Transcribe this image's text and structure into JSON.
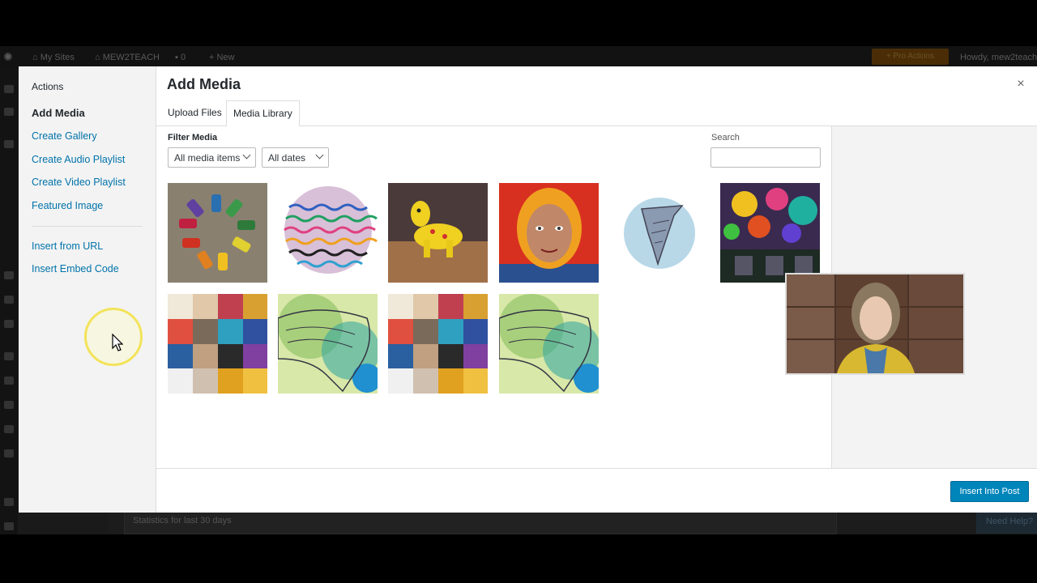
{
  "admin_bar": {
    "my_sites": "My Sites",
    "site_name": "MEW2TEACH",
    "comments_count": "0",
    "new_label": "New",
    "pro_actions": "Pro Actions",
    "howdy": "Howdy, mew2teach"
  },
  "admin_background": {
    "stats_title": "Statistics for last 30 days",
    "help_tab": "Need Help?"
  },
  "modal": {
    "title": "Add Media",
    "close_label": "×",
    "menu": {
      "heading": "Actions",
      "items": [
        {
          "label": "Add Media",
          "active": true
        },
        {
          "label": "Create Gallery"
        },
        {
          "label": "Create Audio Playlist"
        },
        {
          "label": "Create Video Playlist"
        },
        {
          "label": "Featured Image"
        },
        {
          "label": "Insert from URL"
        },
        {
          "label": "Insert Embed Code"
        }
      ]
    },
    "tabs": [
      {
        "label": "Upload Files"
      },
      {
        "label": "Media Library",
        "active": true
      }
    ],
    "filters": {
      "label": "Filter Media",
      "media_type": "All media items",
      "dates": "All dates"
    },
    "search": {
      "label": "Search",
      "value": ""
    },
    "media_items": [
      {
        "name": "toy-cars-color-wheel-image"
      },
      {
        "name": "wavy-line-circle-art-image"
      },
      {
        "name": "yellow-clay-dog-image"
      },
      {
        "name": "self-portrait-red-hair-image"
      },
      {
        "name": "hammerhead-shark-watercolor-image"
      },
      {
        "name": "colorful-mural-building-image"
      },
      {
        "name": "portrait-collage-poster-image"
      },
      {
        "name": "elephant-watercolor-image"
      },
      {
        "name": "portrait-collage-poster-image-2"
      },
      {
        "name": "elephant-watercolor-image-2"
      }
    ],
    "insert_button": "Insert Into Post"
  },
  "colors": {
    "link": "#0073aa",
    "primary_button": "#0085ba",
    "cursor_highlight": "#f3e35a"
  }
}
